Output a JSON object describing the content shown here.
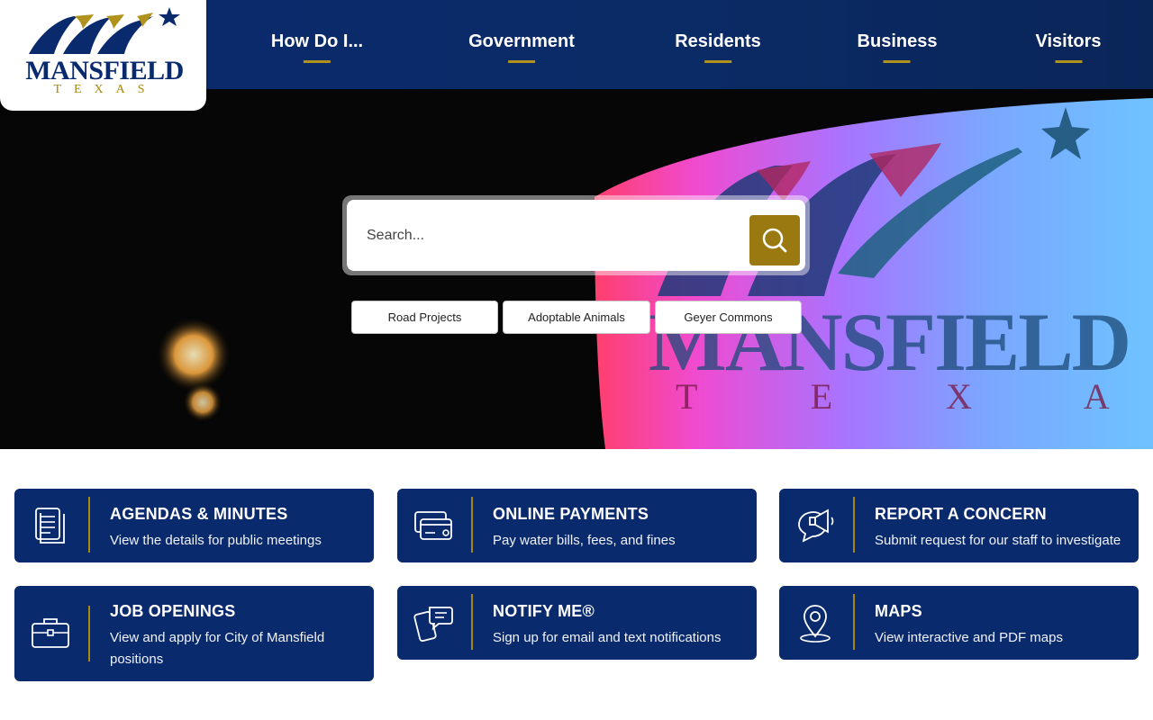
{
  "logo": {
    "name": "MANSFIELD",
    "sub": "TEXAS"
  },
  "nav": {
    "items": [
      {
        "label": "How Do I..."
      },
      {
        "label": "Government"
      },
      {
        "label": "Residents"
      },
      {
        "label": "Business"
      },
      {
        "label": "Visitors"
      }
    ]
  },
  "hero": {
    "sign_name": "MANSFIELD",
    "sign_sub": "T E X A S"
  },
  "search": {
    "placeholder": "Search...",
    "button_icon": "search-icon"
  },
  "quick_links": [
    {
      "label": "Road Projects"
    },
    {
      "label": "Adoptable Animals"
    },
    {
      "label": "Geyer Commons"
    }
  ],
  "cards": [
    {
      "title": "AGENDAS & MINUTES",
      "desc": "View the details for public meetings",
      "icon": "document-icon"
    },
    {
      "title": "ONLINE PAYMENTS",
      "desc": "Pay water bills, fees, and fines",
      "icon": "credit-card-icon"
    },
    {
      "title": "REPORT A CONCERN",
      "desc": "Submit request for our staff to investigate",
      "icon": "megaphone-chat-icon"
    },
    {
      "title": "JOB OPENINGS",
      "desc": "View and apply for City of Mansfield positions",
      "icon": "briefcase-icon"
    },
    {
      "title": "NOTIFY ME®",
      "desc": "Sign up for email and text notifications",
      "icon": "phone-message-icon"
    },
    {
      "title": "MAPS",
      "desc": "View interactive and PDF maps",
      "icon": "map-pin-icon"
    }
  ],
  "colors": {
    "navy": "#0a2a6e",
    "gold": "#a8870d",
    "search_button": "#9a7a10"
  }
}
